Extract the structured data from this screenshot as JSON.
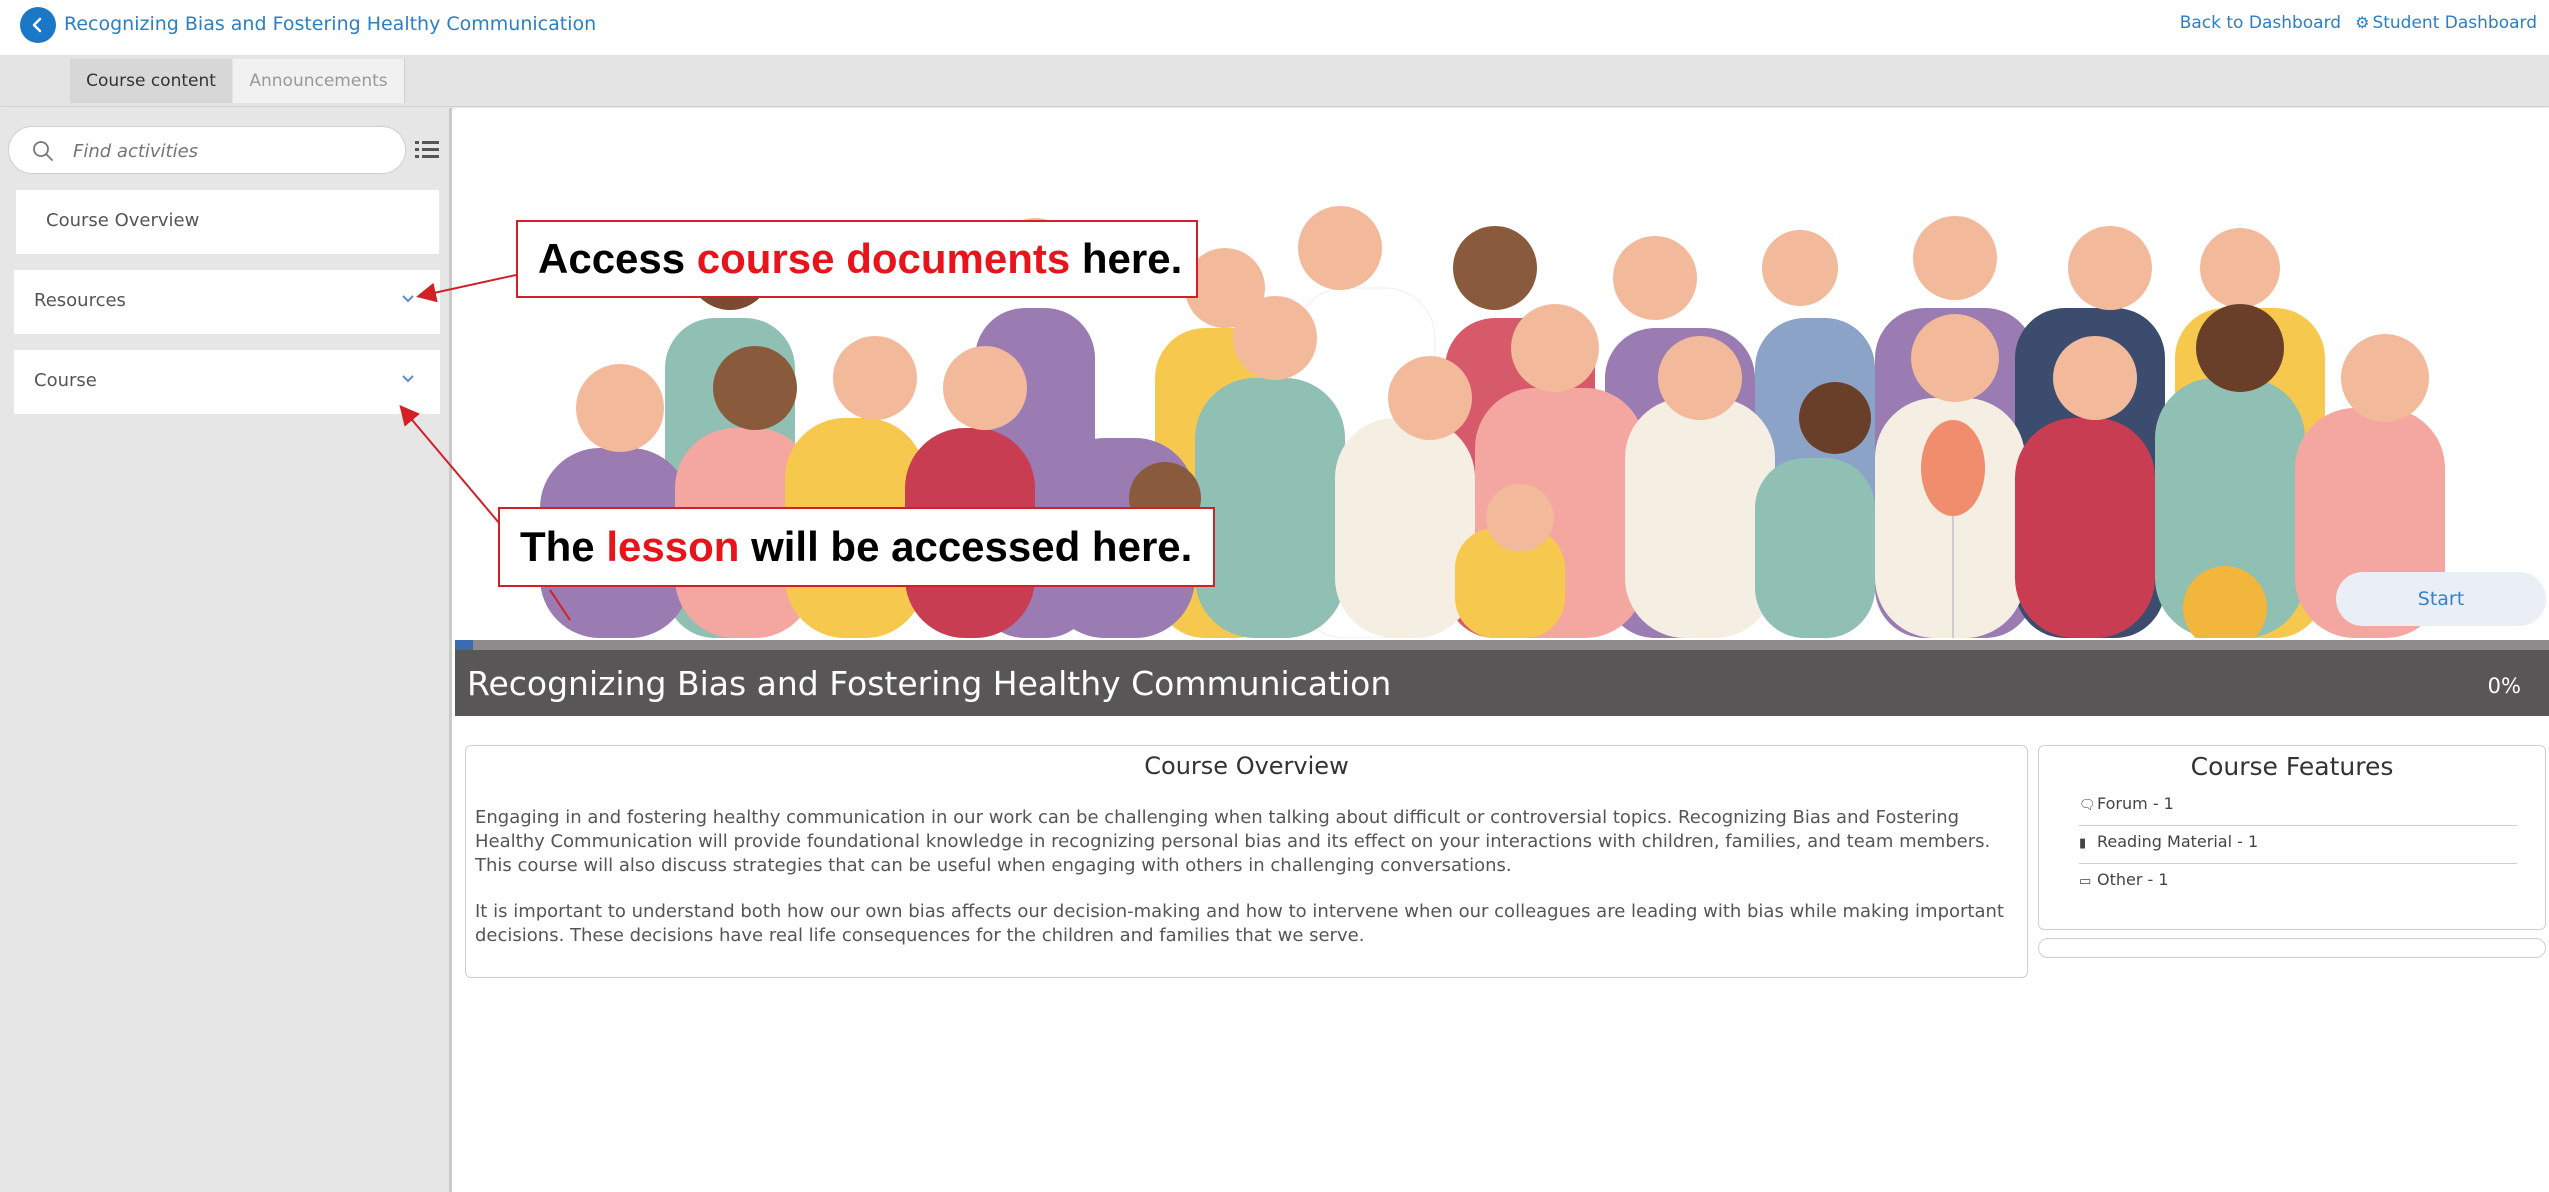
{
  "header": {
    "course_title": "Recognizing Bias and Fostering Healthy Communication",
    "back_to_dashboard": "Back to Dashboard",
    "student_dashboard": "Student Dashboard"
  },
  "tabs": [
    {
      "label": "Course content",
      "active": true
    },
    {
      "label": "Announcements",
      "active": false
    }
  ],
  "sidebar": {
    "search_placeholder": "Find activities",
    "items": [
      {
        "label": "Course Overview"
      },
      {
        "label": "Resources"
      },
      {
        "label": "Course"
      }
    ]
  },
  "hero": {
    "start_label": "Start"
  },
  "course_bar": {
    "title": "Recognizing Bias and Fostering Healthy Communication",
    "progress_text": "0%",
    "progress": 0
  },
  "overview": {
    "heading": "Course Overview",
    "paragraph1": "Engaging in and fostering healthy communication in our work can be challenging when talking about difficult or controversial topics. Recognizing Bias and Fostering Healthy Communication will provide foundational knowledge in recognizing personal bias and its effect on your interactions with children, families, and team members. This course will also discuss strategies that can be useful when engaging with others in challenging conversations.",
    "paragraph2": "It is important to understand both how our own bias affects our decision-making and how to intervene when our colleagues are leading with bias while making important decisions. These decisions have real life consequences for the children and families that we serve."
  },
  "features": {
    "heading": "Course Features",
    "items": [
      {
        "icon": "forum-icon",
        "label": "Forum - 1"
      },
      {
        "icon": "book-icon",
        "label": "Reading Material - 1"
      },
      {
        "icon": "calendar-icon",
        "label": "Other - 1"
      }
    ]
  },
  "annotations": {
    "a1_pre": "Access ",
    "a1_red": "course documents",
    "a1_post": " here.",
    "a2_pre": "The ",
    "a2_red": "lesson",
    "a2_post": " will be accessed here."
  },
  "colors": {
    "brand_blue": "#2a7fc7",
    "title_bar": "#585656",
    "annotation_red": "#e8141c"
  }
}
